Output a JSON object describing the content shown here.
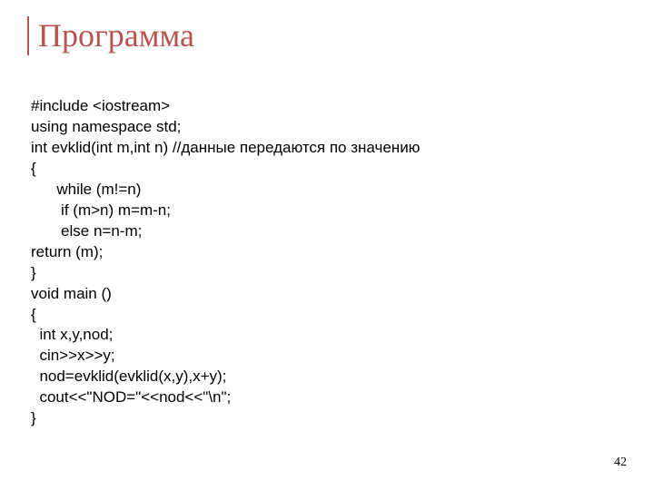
{
  "slide": {
    "title": "Программа",
    "page_number": "42",
    "code_lines": {
      "l0": "#include <iostream>",
      "l1": "using namespace std;",
      "l2": "int evklid(int m,int n) //данные передаются по значению",
      "l3": "{",
      "l4": "      while (m!=n)",
      "l5": "       if (m>n) m=m-n;",
      "l6": "       else n=n-m;",
      "l7": "return (m);",
      "l8": "}",
      "l9": "void main ()",
      "l10": "{",
      "l11": "  int x,y,nod;",
      "l12": "  cin>>x>>y;",
      "l13": "  nod=evklid(evklid(x,y),x+y);",
      "l14": "  cout<<\"NOD=\"<<nod<<\"\\n\";",
      "l15": "}"
    }
  }
}
